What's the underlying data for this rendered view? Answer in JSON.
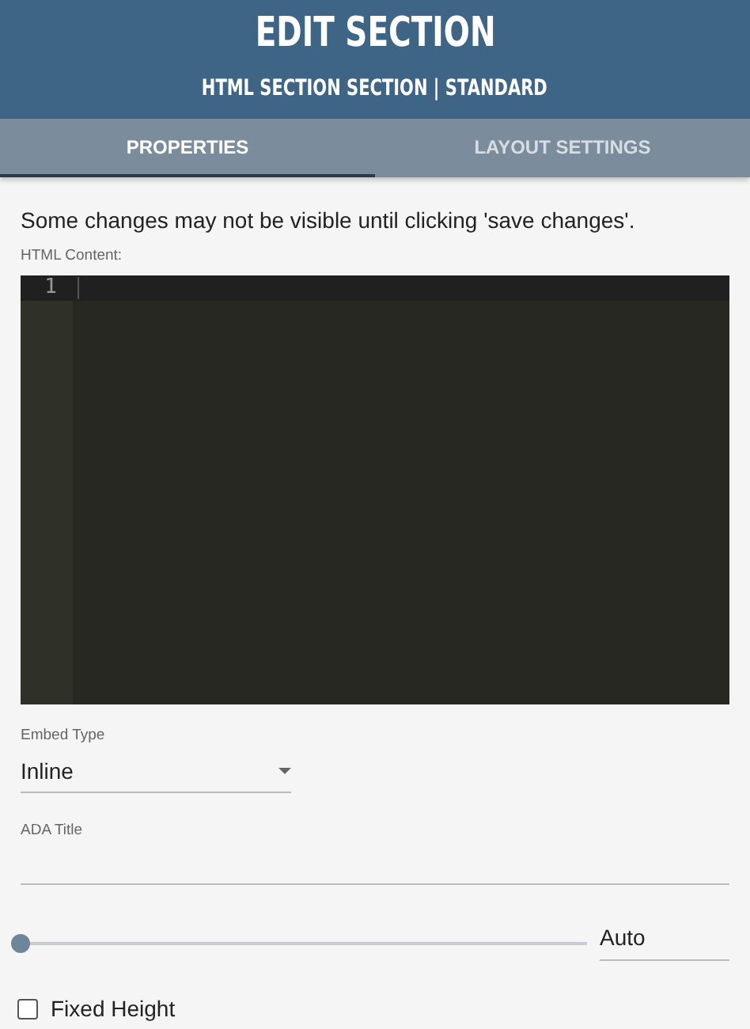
{
  "header": {
    "title": "EDIT SECTION",
    "subtitle": "HTML SECTION SECTION | STANDARD"
  },
  "tabs": [
    {
      "label": "PROPERTIES",
      "selected": true
    },
    {
      "label": "LAYOUT SETTINGS",
      "selected": false
    }
  ],
  "notice": "Some changes may not be visible until clicking 'save changes'.",
  "editor": {
    "label": "HTML Content:",
    "line_numbers": [
      "1"
    ]
  },
  "embed_type": {
    "label": "Embed Type",
    "value": "Inline"
  },
  "ada_title": {
    "label": "ADA Title"
  },
  "height_slider": {
    "level": 0,
    "value": "Auto"
  },
  "fixed_height": {
    "label": "Fixed Height",
    "checked": false
  }
}
